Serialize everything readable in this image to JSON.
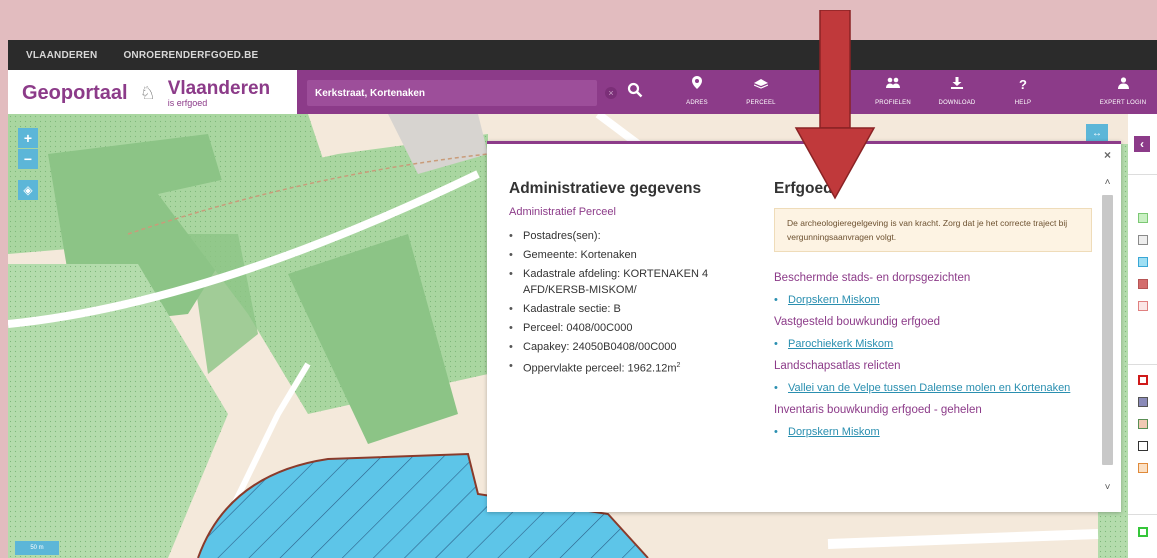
{
  "topbar": {
    "links": [
      "VLAANDEREN",
      "ONROERENDERFGOED.BE"
    ]
  },
  "header": {
    "brand_geoportaal": "Geoportaal",
    "brand_vlaanderen": "Vlaanderen",
    "brand_tagline": "is erfgoed",
    "search_value": "Kerkstraat, Kortenaken",
    "nav": [
      {
        "label": "ADRES",
        "icon": "map-pin-icon"
      },
      {
        "label": "PERCEEL",
        "icon": "parcel-icon"
      },
      {
        "label": "PROFIELEN",
        "icon": "users-icon"
      },
      {
        "label": "DOWNLOAD",
        "icon": "download-icon"
      },
      {
        "label": "HELP",
        "icon": "question-icon"
      },
      {
        "label": "EXPERT LOGIN",
        "icon": "user-icon"
      }
    ]
  },
  "map": {
    "scale_label": "50 m",
    "colors": {
      "field_green": "#a9d6a0",
      "dark_green": "#8cc486",
      "water_blue": "#5dc5e8",
      "road": "#ffffff"
    }
  },
  "popup": {
    "admin": {
      "title": "Administratieve gegevens",
      "subtitle": "Administratief Perceel",
      "items": [
        "Postadres(sen):",
        "Gemeente: Kortenaken",
        "Kadastrale afdeling: KORTENAKEN 4 AFD/KERSB-MISKOM/",
        "Kadastrale sectie: B",
        "Perceel: 0408/00C000",
        "Capakey: 24050B0408/00C000"
      ],
      "area_label": "Oppervlakte perceel: 1962.12m",
      "area_unit_sup": "2"
    },
    "erfgoed": {
      "title": "Erfgoed",
      "notice": "De archeologieregelgeving is van kracht. Zorg dat je het correcte traject bij vergunningsaanvragen volgt.",
      "sections": [
        {
          "category": "Beschermde stads- en dorpsgezichten",
          "links": [
            "Dorpskern Miskom"
          ]
        },
        {
          "category": "Vastgesteld bouwkundig erfgoed",
          "links": [
            "Parochiekerk Miskom"
          ]
        },
        {
          "category": "Landschapsatlas relicten",
          "links": [
            "Vallei van de Velpe tussen Dalemse molen en Kortenaken"
          ]
        },
        {
          "category": "Inventaris bouwkundig erfgoed - gehelen",
          "links": [
            "Dorpskern Miskom"
          ]
        }
      ]
    }
  },
  "annotation": {
    "arrow_color": "#c0393b"
  }
}
